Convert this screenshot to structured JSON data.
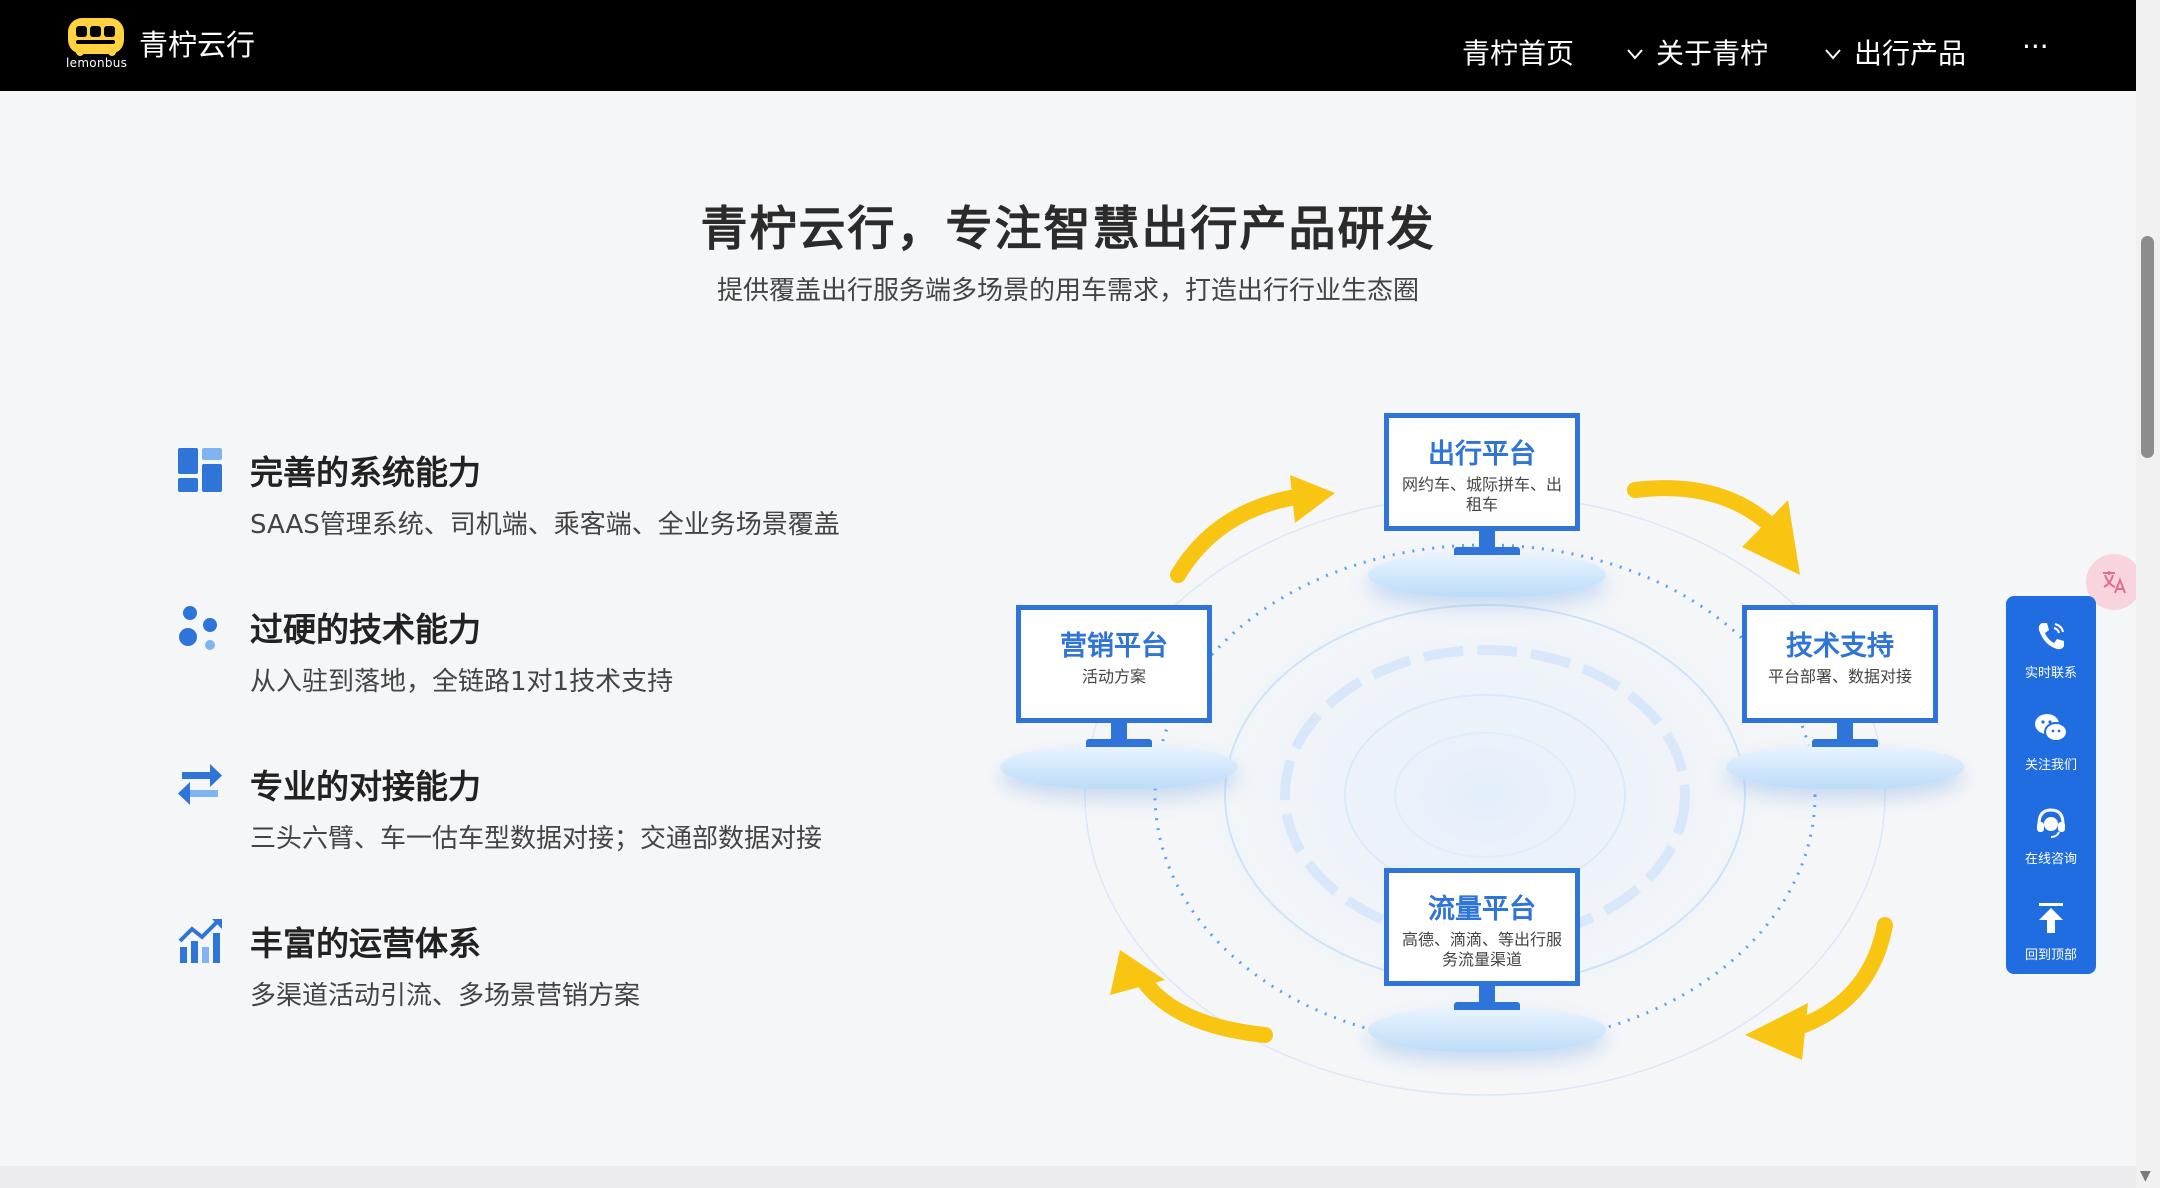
{
  "header": {
    "brand": "青柠云行",
    "logo_text": "lemonbus",
    "nav": [
      {
        "label": "青柠首页",
        "has_chevron": false
      },
      {
        "label": "关于青柠",
        "has_chevron": true
      },
      {
        "label": "出行产品",
        "has_chevron": true
      },
      {
        "label": "···",
        "has_chevron": false
      }
    ]
  },
  "section": {
    "title": "青柠云行，专注智慧出行产品研发",
    "subtitle": "提供覆盖出行服务端多场景的用车需求，打造出行行业生态圈"
  },
  "features": [
    {
      "icon": "grid-icon",
      "title": "完善的系统能力",
      "desc": "SAAS管理系统、司机端、乘客端、全业务场景覆盖"
    },
    {
      "icon": "molecule-icon",
      "title": "过硬的技术能力",
      "desc": "从入驻到落地，全链路1对1技术支持"
    },
    {
      "icon": "exchange-arrows-icon",
      "title": "专业的对接能力",
      "desc": "三头六臂、车一估车型数据对接；交通部数据对接"
    },
    {
      "icon": "growth-chart-icon",
      "title": "丰富的运营体系",
      "desc": "多渠道活动引流、多场景营销方案"
    }
  ],
  "diagram": {
    "top": {
      "title": "出行平台",
      "desc": "网约车、城际拼车、出租车"
    },
    "left": {
      "title": "营销平台",
      "desc": "活动方案"
    },
    "right": {
      "title": "技术支持",
      "desc": "平台部署、数据对接"
    },
    "bottom": {
      "title": "流量平台",
      "desc": "高德、滴滴、等出行服务流量渠道"
    }
  },
  "side_panel": [
    {
      "icon": "phone-icon",
      "label": "实时联系"
    },
    {
      "icon": "wechat-icon",
      "label": "关注我们"
    },
    {
      "icon": "headset-icon",
      "label": "在线咨询"
    },
    {
      "icon": "back-to-top-icon",
      "label": "回到顶部"
    }
  ],
  "translate_label": "",
  "colors": {
    "accent": "#2f74d8",
    "panel": "#1f6de0",
    "arrow": "#f9c513",
    "header": "#000000"
  }
}
